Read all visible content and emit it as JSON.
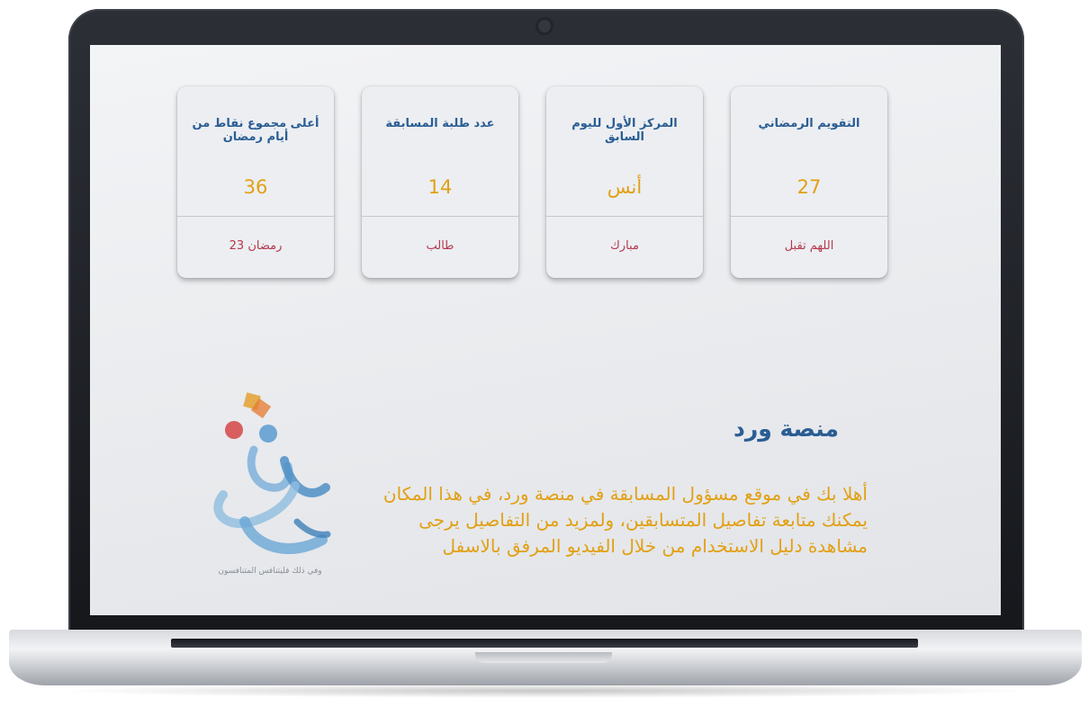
{
  "cards": [
    {
      "title": "التقويم الرمضاني",
      "value": "27",
      "footer": "اللهم تقبل"
    },
    {
      "title": "المركز الأول لليوم السابق",
      "value": "أنس",
      "footer": "مبارك"
    },
    {
      "title": "عدد طلبة المسابقة",
      "value": "14",
      "footer": "طالب"
    },
    {
      "title": "أعلى مجموع نقاط من أيام رمضان",
      "value": "36",
      "footer": "رمضان 23"
    }
  ],
  "intro": {
    "title": "منصة ورد",
    "text": "أهلا بك في موقع مسؤول المسابقة في منصة ورد، في هذا المكان يمكنك متابعة تفاصيل المتسابقين، ولمزيد من التفاصيل يرجى مشاهدة دليل الاستخدام من خلال الفيديو المرفق بالاسفل"
  },
  "logo": {
    "icon": "ward-calligraphy-logo",
    "tagline": "وفي ذلك فليتنافس المتنافسون"
  },
  "colors": {
    "accent_blue": "#2a5d93",
    "accent_gold": "#e2a013",
    "accent_red": "#b5384c",
    "screen_bg": "#eceef2"
  }
}
